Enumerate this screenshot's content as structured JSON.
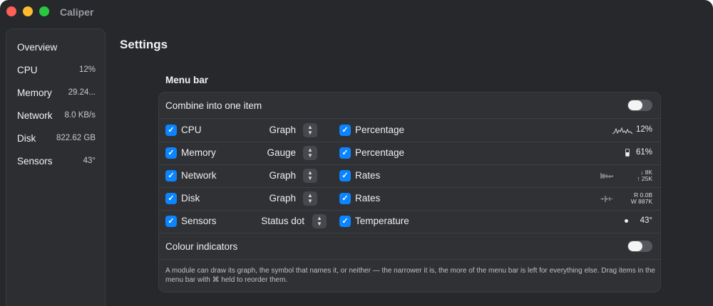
{
  "window": {
    "title": "Caliper"
  },
  "sidebar": {
    "items": [
      {
        "label": "Overview",
        "value": ""
      },
      {
        "label": "CPU",
        "value": "12%"
      },
      {
        "label": "Memory",
        "value": "29.24..."
      },
      {
        "label": "Network",
        "value": "8.0 KB/s"
      },
      {
        "label": "Disk",
        "value": "822.62 GB"
      },
      {
        "label": "Sensors",
        "value": "43°"
      }
    ]
  },
  "settings": {
    "title": "Settings",
    "section_title": "Menu bar",
    "combine_label": "Combine into one item",
    "combine_on": false,
    "colour_label": "Colour indicators",
    "colour_on": false,
    "modules": [
      {
        "name": "CPU",
        "checked": true,
        "style": "Graph",
        "metric": "Percentage",
        "metric_checked": true,
        "preview": "12%",
        "preview_icon": "sparkline-icon"
      },
      {
        "name": "Memory",
        "checked": true,
        "style": "Gauge",
        "metric": "Percentage",
        "metric_checked": true,
        "preview": "61%",
        "preview_icon": "battery-gauge-icon",
        "gauge_level": 0.6
      },
      {
        "name": "Network",
        "checked": true,
        "style": "Graph",
        "metric": "Rates",
        "metric_checked": true,
        "preview_up": "↓ 8K",
        "preview_down": "↑ 25K",
        "preview_icon": "bar-graph-icon"
      },
      {
        "name": "Disk",
        "checked": true,
        "style": "Graph",
        "metric": "Rates",
        "metric_checked": true,
        "preview_up": "R 0.0B",
        "preview_down": "W 887K",
        "preview_icon": "bar-graph-icon"
      },
      {
        "name": "Sensors",
        "checked": true,
        "style": "Status dot",
        "metric": "Temperature",
        "metric_checked": true,
        "preview": "43°",
        "preview_icon": "status-dot-icon"
      }
    ],
    "footnote": "A module can draw its graph, the symbol that names it, or neither — the narrower it is, the more of the menu bar is left for everything else. Drag items in the menu bar with ⌘ held to reorder them."
  },
  "colors": {
    "accent": "#0a84ff",
    "window_bg": "#26282c",
    "panel_bg": "#2f3135"
  }
}
